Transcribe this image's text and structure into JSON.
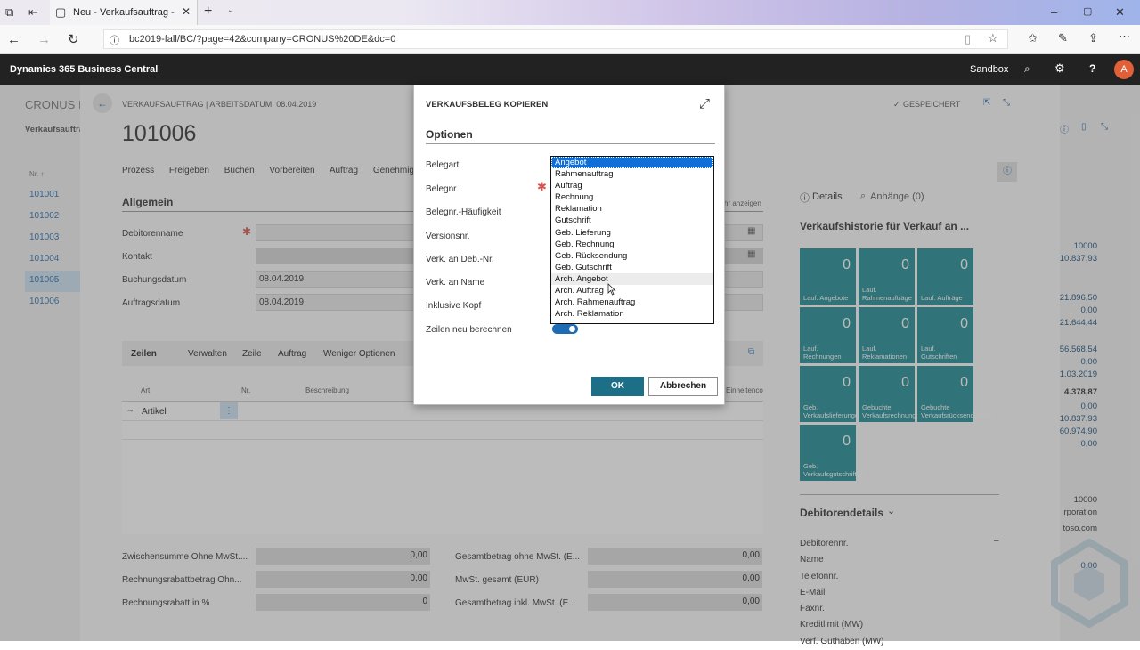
{
  "browser": {
    "tab_title": "Neu - Verkaufsauftrag -",
    "url": "bc2019-fall/BC/?page=42&company=CRONUS%20DE&dc=0"
  },
  "bc_header": {
    "app_name": "Dynamics 365 Business Central",
    "env": "Sandbox",
    "avatar": "A"
  },
  "background": {
    "company": "CRONUS I",
    "list_title": "Verkaufsauftrag",
    "sort_col": "Nr. ↑",
    "list_items": [
      "101001",
      "101002",
      "101003",
      "101004",
      "101005",
      "101006"
    ],
    "card_title": "VERKAUFSAUFTRAG | ARBEITSDATUM: 08.04.2019",
    "doc_no": "101006",
    "saved": "GESPEICHERT",
    "actions": [
      "Prozess",
      "Freigeben",
      "Buchen",
      "Vorbereiten",
      "Auftrag",
      "Genehmig"
    ],
    "section": "Allgemein",
    "show_more": "hr anzeigen",
    "fields": [
      {
        "label": "Debitorenname",
        "value": ""
      },
      {
        "label": "Kontakt",
        "value": ""
      },
      {
        "label": "Buchungsdatum",
        "value": "08.04.2019"
      },
      {
        "label": "Auftragsdatum",
        "value": "08.04.2019"
      }
    ],
    "lines_tabs": [
      "Zeilen",
      "Verwalten",
      "Zeile",
      "Auftrag",
      "Weniger Optionen"
    ],
    "lines_cols": [
      "Art",
      "Nr.",
      "Beschreibung",
      "Einheitenco"
    ],
    "line_type": "Artikel",
    "totals": [
      {
        "label": "Zwischensumme Ohne MwSt....",
        "value": "0,00"
      },
      {
        "label": "Rechnungsrabattbetrag Ohn...",
        "value": "0,00"
      },
      {
        "label": "Rechnungsrabatt in %",
        "value": "0"
      },
      {
        "label": "Gesamtbetrag ohne MwSt. (E...",
        "value": "0,00"
      },
      {
        "label": "MwSt. gesamt (EUR)",
        "value": "0,00"
      },
      {
        "label": "Gesamtbetrag inkl. MwSt. (E...",
        "value": "0,00"
      }
    ],
    "factbox_tabs": {
      "details": "Details",
      "attach": "Anhänge (0)"
    },
    "history_title": "Verkaufshistorie für Verkauf an ...",
    "tiles": [
      {
        "n": "0",
        "t": "Lauf. Angebote"
      },
      {
        "n": "0",
        "t": "Lauf. Rahmenaufträge"
      },
      {
        "n": "0",
        "t": "Lauf. Aufträge"
      },
      {
        "n": "0",
        "t": "Lauf. Rechnungen"
      },
      {
        "n": "0",
        "t": "Lauf. Reklamationen"
      },
      {
        "n": "0",
        "t": "Lauf. Gutschriften"
      },
      {
        "n": "0",
        "t": "Geb. Verkaufslieferungen"
      },
      {
        "n": "0",
        "t": "Gebuchte Verkaufsrechnungen"
      },
      {
        "n": "0",
        "t": "Gebuchte Verkaufsrücksendungen"
      },
      {
        "n": "0",
        "t": "Geb. Verkaufsgutschriften"
      }
    ],
    "debitor_title": "Debitorendetails",
    "debitor_fields": [
      "Debitorennr.",
      "Name",
      "Telefonnr.",
      "E-Mail",
      "Faxnr.",
      "Kreditlimit (MW)",
      "Verf. Guthaben (MW)"
    ],
    "debitor_dash": "–",
    "right_values": [
      "10000",
      "10.837,93",
      "21.896,50",
      "0,00",
      "21.644,44",
      "56.568,54",
      "0,00",
      "1.03.2019",
      "4.378,87",
      "0,00",
      "10.837,93",
      "60.974,90",
      "0,00",
      "10000",
      "rporation",
      "toso.com",
      "0,00"
    ]
  },
  "dialog": {
    "title": "VERKAUFSBELEG KOPIEREN",
    "section": "Optionen",
    "labels": [
      "Belegart",
      "Belegnr.",
      "Belegnr.-Häufigkeit",
      "Versionsnr.",
      "Verk. an Deb.-Nr.",
      "Verk. an Name",
      "Inklusive Kopf",
      "Zeilen neu berechnen"
    ],
    "options": [
      "Angebot",
      "Rahmenauftrag",
      "Auftrag",
      "Rechnung",
      "Reklamation",
      "Gutschrift",
      "Geb. Lieferung",
      "Geb. Rechnung",
      "Geb. Rücksendung",
      "Geb. Gutschrift",
      "Arch. Angebot",
      "Arch. Auftrag",
      "Arch. Rahmenauftrag",
      "Arch. Reklamation"
    ],
    "ok": "OK",
    "cancel": "Abbrechen"
  }
}
